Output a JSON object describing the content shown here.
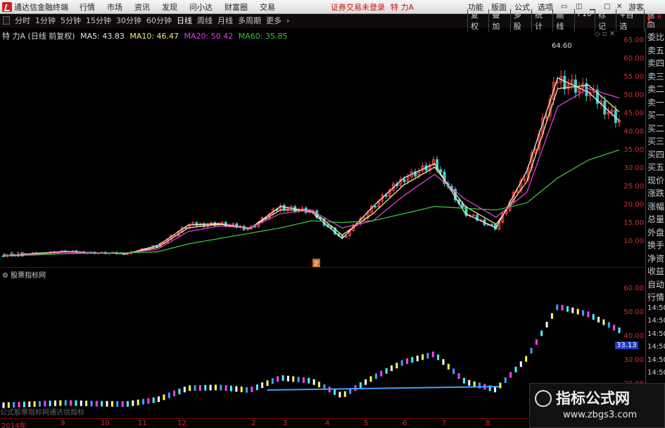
{
  "menubar": {
    "app_title": "通达信金融终端",
    "menus": [
      "行情",
      "市场",
      "资讯",
      "发现",
      "问小达",
      "财富圈",
      "交易"
    ],
    "notice": "证券交易未登录",
    "stock_name": "特 力A",
    "right_menus": [
      "功能",
      "版面",
      "公式",
      "选项"
    ],
    "guest": "游客"
  },
  "periodbar": {
    "tabs": [
      "分时",
      "1分钟",
      "5分钟",
      "15分钟",
      "30分钟",
      "60分钟",
      "日线",
      "周线",
      "月线",
      "多周期",
      "更多"
    ],
    "active_tab": "日线",
    "tools": [
      "复权",
      "叠加",
      "多股",
      "统计",
      "画线",
      "F10",
      "标记",
      "+自选",
      "返回"
    ],
    "badge_l": "L",
    "badge_r": "R"
  },
  "legend": {
    "title": "特 力A (日线 前复权)",
    "ma5": "MA5: 43.83",
    "ma10": "MA10: 46.47",
    "ma20": "MA20: 50.42",
    "ma60": "MA60: 35.85"
  },
  "annotations": {
    "peak": "64.60",
    "start": "6.18",
    "mid_tag": "定"
  },
  "yaxis_main": [
    "65.00",
    "60.00",
    "55.00",
    "50.00",
    "45.00",
    "40.00",
    "35.00",
    "30.00",
    "25.00",
    "20.00",
    "15.00",
    "10.00"
  ],
  "yaxis_ind": [
    "60.00",
    "50.00",
    "40.00",
    "30.00",
    "20.00"
  ],
  "ind_header": "股票指标网",
  "price_label": "33.13",
  "sidepanel": {
    "items": [
      "委比",
      "卖五",
      "卖四",
      "卖三",
      "卖二",
      "卖一",
      "买一",
      "买二",
      "买三",
      "买四",
      "买五",
      "现价",
      "涨跌",
      "涨幅",
      "总量",
      "外盘",
      "换手",
      "净资",
      "收益",
      "自动",
      "行情",
      "14:50",
      "14:50",
      "14:50",
      "14:50",
      "14:50",
      "14:50",
      "14:50",
      "14:50"
    ]
  },
  "timeaxis": {
    "ticks": [
      "2014年",
      "9",
      "10",
      "11",
      "12",
      "2",
      "3",
      "4",
      "5",
      "6",
      "7",
      "8"
    ]
  },
  "watermark": {
    "formula_text": "公式股票指标网通达信指标",
    "title": "指标公式网",
    "url": "www.zbgs3.com"
  },
  "chart_data": {
    "type": "line",
    "title": "特 力A (日线 前复权)",
    "ylim": [
      5,
      67
    ],
    "x": [
      0,
      5,
      10,
      15,
      20,
      25,
      30,
      35,
      40,
      45,
      50,
      55,
      60,
      65,
      70,
      75,
      80,
      85,
      90,
      95,
      100
    ],
    "series": [
      {
        "name": "MA5",
        "values": [
          6.2,
          6.8,
          7.4,
          7.0,
          6.8,
          9.0,
          14.8,
          15.2,
          13.8,
          20.0,
          18.5,
          11.0,
          20.0,
          28.0,
          32.0,
          18.0,
          14.0,
          30.0,
          56.0,
          52.0,
          44.0
        ]
      },
      {
        "name": "MA10",
        "values": [
          6.2,
          6.7,
          7.3,
          7.0,
          6.9,
          8.5,
          14.0,
          15.0,
          14.0,
          19.0,
          19.0,
          12.0,
          18.0,
          26.0,
          31.0,
          20.0,
          15.0,
          27.0,
          53.0,
          54.0,
          46.5
        ]
      },
      {
        "name": "MA20",
        "values": [
          6.2,
          6.6,
          7.2,
          7.0,
          7.0,
          8.0,
          13.0,
          14.5,
          14.0,
          18.0,
          19.0,
          14.0,
          16.0,
          23.0,
          29.0,
          22.0,
          17.0,
          24.0,
          48.0,
          53.0,
          50.4
        ]
      },
      {
        "name": "MA60",
        "values": [
          6.2,
          6.4,
          6.8,
          6.9,
          7.0,
          7.3,
          9.5,
          11.0,
          12.5,
          14.0,
          16.0,
          15.5,
          16.0,
          18.0,
          20.0,
          19.5,
          19.0,
          21.0,
          28.0,
          33.0,
          35.85
        ]
      }
    ]
  }
}
